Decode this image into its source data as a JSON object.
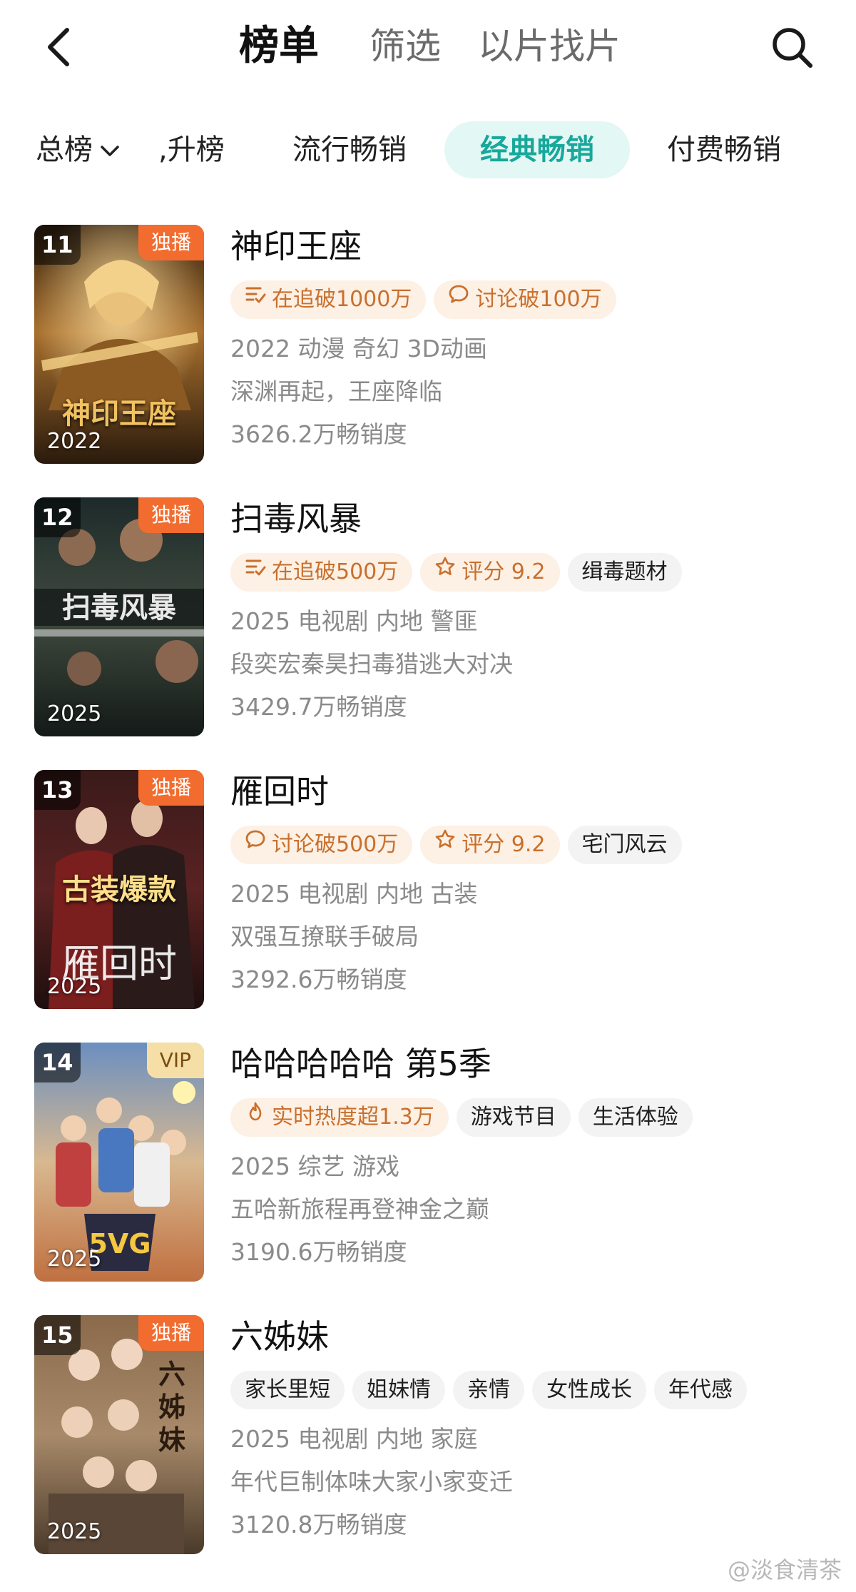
{
  "header": {
    "tabs": [
      {
        "label": "榜单"
      },
      {
        "label": "筛选"
      },
      {
        "label": "以片找片"
      }
    ]
  },
  "subtabs": [
    {
      "label": "总榜"
    },
    {
      "label": ",升榜"
    },
    {
      "label": "流行畅销"
    },
    {
      "label": "经典畅销"
    },
    {
      "label": "付费畅销"
    }
  ],
  "items": [
    {
      "rank": "11",
      "badge": "独播",
      "poster_year": "2022",
      "poster_caption": "神印王座",
      "title": "神印王座",
      "tags": [
        {
          "icon": "list-icon",
          "label": "在追破1000万"
        },
        {
          "icon": "comment-icon",
          "label": "讨论破100万"
        }
      ],
      "meta": "2022 动漫 奇幻 3D动画",
      "desc": "深渊再起，王座降临",
      "sales": "3626.2万畅销度"
    },
    {
      "rank": "12",
      "badge": "独播",
      "poster_year": "2025",
      "poster_caption": "扫毒风暴",
      "title": "扫毒风暴",
      "tags": [
        {
          "icon": "list-icon",
          "label": "在追破500万"
        },
        {
          "icon": "star-icon",
          "label": "评分 9.2"
        },
        {
          "icon": "",
          "label": "缉毒题材"
        }
      ],
      "meta": "2025 电视剧 内地 警匪",
      "desc": "段奕宏秦昊扫毒猎逃大对决",
      "sales": "3429.7万畅销度"
    },
    {
      "rank": "13",
      "badge": "独播",
      "poster_year": "2025",
      "poster_caption": "古装爆款",
      "title": "雁回时",
      "tags": [
        {
          "icon": "comment-icon",
          "label": "讨论破500万"
        },
        {
          "icon": "star-icon",
          "label": "评分 9.2"
        },
        {
          "icon": "",
          "label": "宅门风云"
        }
      ],
      "meta": "2025 电视剧 内地 古装",
      "desc": "双强互撩联手破局",
      "sales": "3292.6万畅销度"
    },
    {
      "rank": "14",
      "badge": "VIP",
      "poster_year": "2025",
      "poster_caption": "",
      "title": "哈哈哈哈哈 第5季",
      "tags": [
        {
          "icon": "flame-icon",
          "label": "实时热度超1.3万"
        },
        {
          "icon": "",
          "label": "游戏节目"
        },
        {
          "icon": "",
          "label": "生活体验"
        }
      ],
      "meta": "2025 综艺 游戏",
      "desc": "五哈新旅程再登神金之巅",
      "sales": "3190.6万畅销度"
    },
    {
      "rank": "15",
      "badge": "独播",
      "poster_year": "2025",
      "poster_caption": "六姊妹",
      "title": "六姊妹",
      "tags": [
        {
          "icon": "",
          "label": "家长里短"
        },
        {
          "icon": "",
          "label": "姐妹情"
        },
        {
          "icon": "",
          "label": "亲情"
        },
        {
          "icon": "",
          "label": "女性成长"
        },
        {
          "icon": "",
          "label": "年代感"
        }
      ],
      "meta": "2025 电视剧 内地 家庭",
      "desc": "年代巨制体味大家小家变迁",
      "sales": "3120.8万畅销度"
    }
  ],
  "watermark": "@淡食清茶",
  "colors": {
    "accent": "#17a89b",
    "accent_bg": "#e3f7f4",
    "badge_exclusive": "#f36c2f",
    "badge_vip": "#f6dfa6",
    "hot_tag_bg": "#fdf0e4",
    "hot_tag_text": "#c8702e"
  }
}
